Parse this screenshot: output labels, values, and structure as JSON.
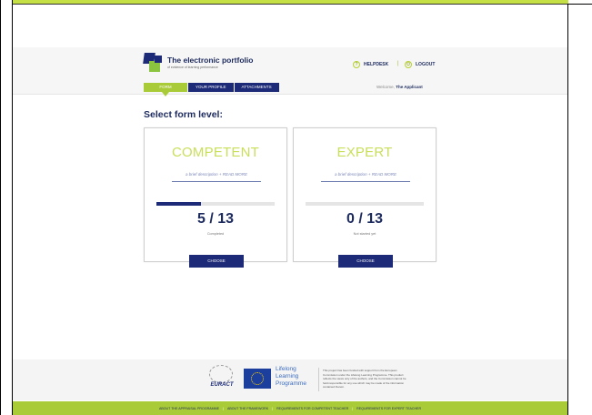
{
  "header": {
    "title": "The electronic portfolio",
    "subtitle": "of evidence of learning performance",
    "helpdesk_label": "HELPDESK",
    "logout_label": "LOGOUT",
    "separator": "|"
  },
  "nav": {
    "tabs": [
      {
        "label": "FORM",
        "active": true
      },
      {
        "label": "YOUR PROFILE",
        "active": false
      },
      {
        "label": "ATTACHMENTS",
        "active": false
      }
    ],
    "welcome_prefix": "Welcome,",
    "welcome_name": "The Applicant"
  },
  "main": {
    "heading": "Select form level:",
    "cards": [
      {
        "title": "COMPETENT",
        "description": "a brief description + READ MORE",
        "count": "5 / 13",
        "status": "Completed",
        "progress_fraction": 0.38,
        "button_label": "CHOOSE"
      },
      {
        "title": "EXPERT",
        "description": "a brief description + READ MORE",
        "count": "0 / 13",
        "status": "Not started yet",
        "progress_fraction": 0,
        "button_label": "CHOOSE"
      }
    ]
  },
  "footer": {
    "euract_label": "EURACT",
    "llp_line1": "Lifelong",
    "llp_line2": "Learning",
    "llp_line3": "Programme",
    "disclaimer": "This project has been funded with support from the European Commission under the Lifelong Learning Programme. This product reflects the views only of the authors, and the Commission cannot be held responsible for any use which may be made of the information contained therein.",
    "links": [
      "ABOUT THE APPRAISAL PROGRAMME",
      "ABOUT THE FRAMEWORK",
      "REQUIREMENTS FOR COMPETENT TEACHER",
      "REQUIREMENTS FOR EXPERT TEACHER"
    ],
    "link_separator": "|"
  },
  "colors": {
    "accent_green": "#a9cb38",
    "brand_navy": "#1c2a78",
    "title_lime": "#c8df5a"
  }
}
